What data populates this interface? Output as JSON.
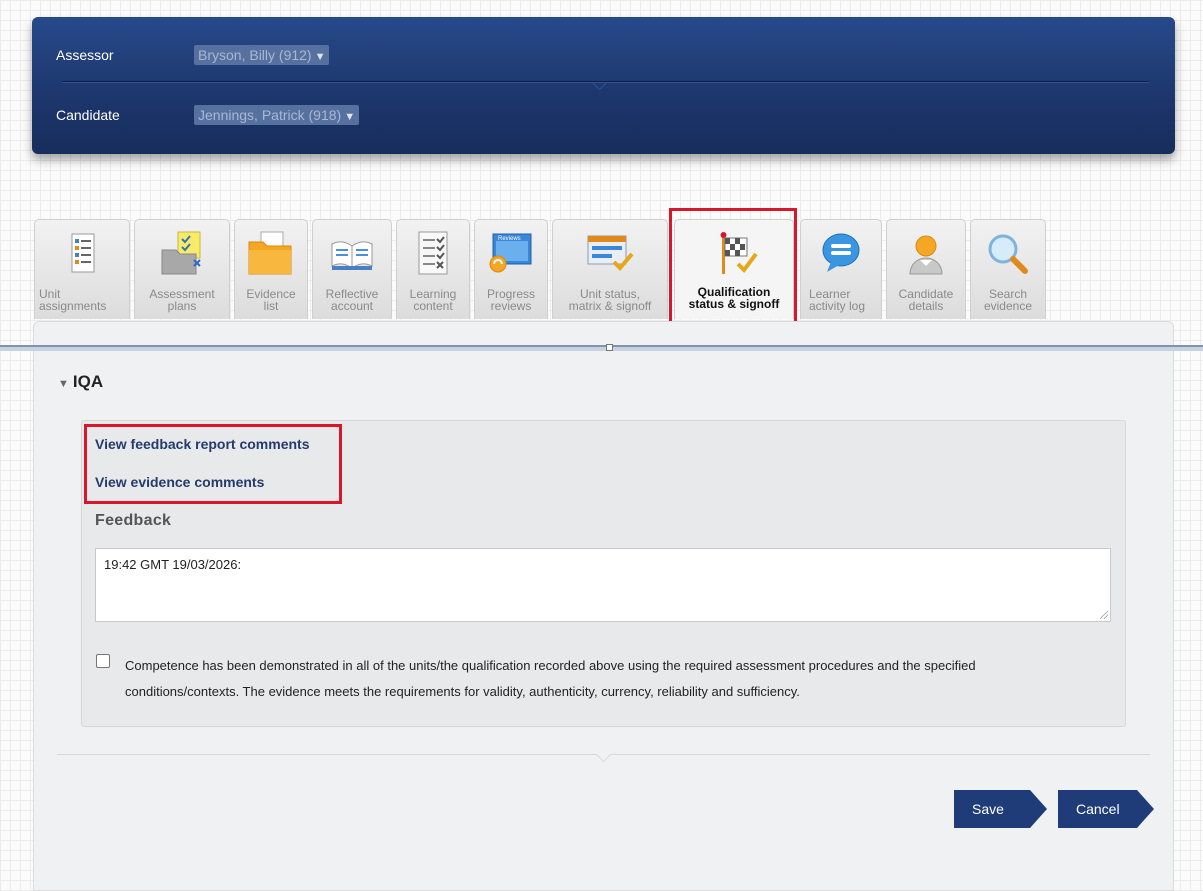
{
  "header": {
    "assessor_label": "Assessor",
    "assessor_value": "Bryson, Billy (912)",
    "candidate_label": "Candidate",
    "candidate_value": "Jennings, Patrick (918)"
  },
  "tabs": [
    {
      "label": "Unit\nassignments",
      "icon": "document-list-icon"
    },
    {
      "label": "Assessment\nplans",
      "icon": "folder-checklist-icon"
    },
    {
      "label": "Evidence\nlist",
      "icon": "folder-icon"
    },
    {
      "label": "Reflective\naccount",
      "icon": "open-book-icon"
    },
    {
      "label": "Learning\ncontent",
      "icon": "checklist-icon"
    },
    {
      "label": "Progress\nreviews",
      "icon": "reviews-icon"
    },
    {
      "label": "Unit status,\nmatrix & signoff",
      "icon": "window-check-icon"
    },
    {
      "label": "Qualification\nstatus & signoff",
      "icon": "checkered-flag-icon",
      "active": true
    },
    {
      "label": "Learner\nactivity log",
      "icon": "speech-bubble-icon"
    },
    {
      "label": "Candidate\ndetails",
      "icon": "person-icon"
    },
    {
      "label": "Search\nevidence",
      "icon": "magnifier-icon"
    }
  ],
  "section": {
    "title": "IQA",
    "link_feedback": "View feedback report comments",
    "link_evidence": "View evidence comments",
    "feedback_label": "Feedback",
    "feedback_value": "19:42 GMT 19/03/2026:",
    "checkbox_text": "Competence has been demonstrated in all of the units/the qualification recorded above using the required assessment procedures and the specified conditions/contexts. The evidence meets the requirements for validity, authenticity, currency, reliability and sufficiency."
  },
  "buttons": {
    "save": "Save",
    "cancel": "Cancel"
  },
  "colors": {
    "header_bg": "#1b3367",
    "button_bg": "#1f3c78",
    "highlight": "#d9172c",
    "link": "#243b6b"
  }
}
